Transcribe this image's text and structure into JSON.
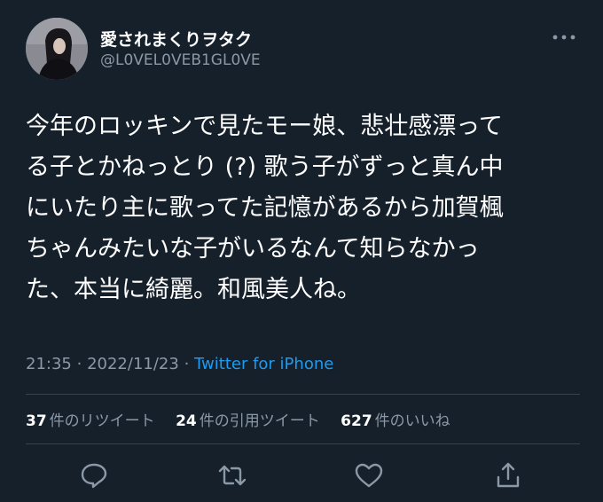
{
  "user": {
    "display_name": "愛されまくりヲタク",
    "handle": "@L0VEL0VEB1GL0VE"
  },
  "tweet": {
    "lines": [
      "今年のロッキンで見たモー娘、悲壮感漂って",
      "る子とかねっとり (?) 歌う子がずっと真ん中",
      "にいたり主に歌ってた記憶があるから加賀楓",
      "ちゃんみたいな子がいるなんて知らなかっ",
      "た、本当に綺麗。和風美人ね。"
    ],
    "time": "21:35",
    "date": "2022/11/23",
    "separator": "·",
    "source": "Twitter for iPhone"
  },
  "stats": {
    "retweets_count": "37",
    "retweets_label": "件のリツイート",
    "quotes_count": "24",
    "quotes_label": "件の引用ツイート",
    "likes_count": "627",
    "likes_label": "件のいいね"
  },
  "icons": {
    "more": "more-icon",
    "reply": "reply-icon",
    "retweet": "retweet-icon",
    "like": "heart-icon",
    "share": "share-icon"
  },
  "colors": {
    "background": "#15202b",
    "text": "#ffffff",
    "secondary_text": "#8b98a5",
    "link": "#1d9bf0",
    "divider": "#38444d"
  }
}
